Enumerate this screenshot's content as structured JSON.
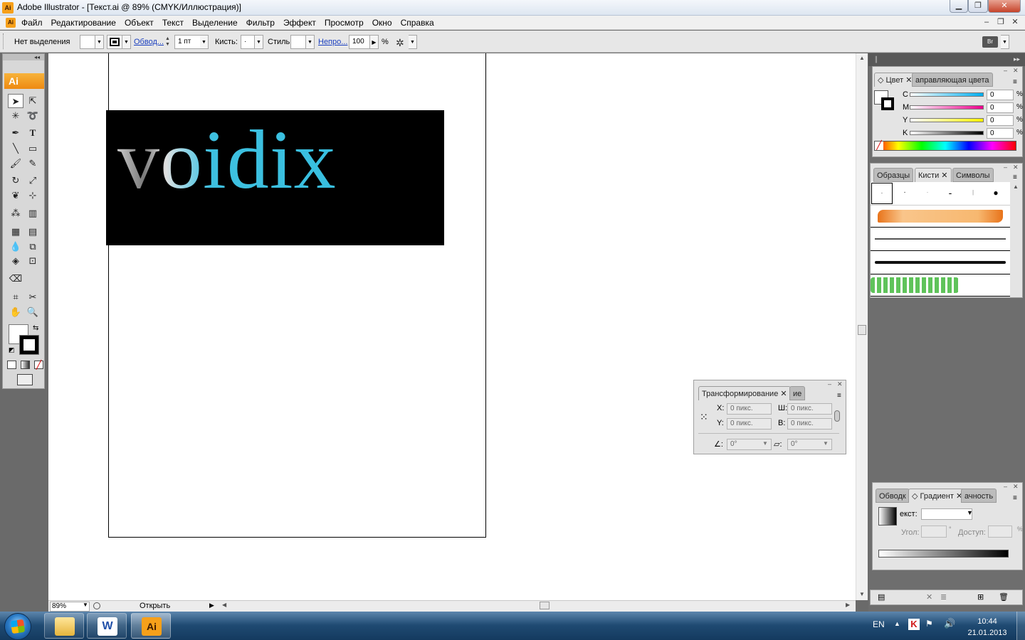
{
  "window": {
    "title": "Adobe Illustrator - [Текст.ai @ 89% (CMYK/Иллюстрация)]",
    "app_icon": "Ai"
  },
  "menu": [
    "Файл",
    "Редактирование",
    "Объект",
    "Текст",
    "Выделение",
    "Фильтр",
    "Эффект",
    "Просмотр",
    "Окно",
    "Справка"
  ],
  "control": {
    "selection_status": "Нет выделения",
    "stroke_link": "Обвод...",
    "stroke_weight": "1 пт",
    "brush_label": "Кисть:",
    "brush_value": "·",
    "style_label": "Стиль:",
    "opacity_link": "Непро...",
    "opacity_value": "100",
    "percent": "%"
  },
  "tools": {
    "logo": "Ai"
  },
  "artwork": {
    "logo_text": "voidix"
  },
  "status": {
    "zoom": "89%",
    "status_text": "Открыть"
  },
  "color_panel": {
    "tab_color": "Цвет",
    "tab_guide": "аправляющая цвета",
    "channels": [
      {
        "label": "C",
        "value": "0",
        "pct": "%"
      },
      {
        "label": "M",
        "value": "0",
        "pct": "%"
      },
      {
        "label": "Y",
        "value": "0",
        "pct": "%"
      },
      {
        "label": "K",
        "value": "0",
        "pct": "%"
      }
    ]
  },
  "brushes_panel": {
    "tab_swatches": "Образцы",
    "tab_brushes": "Кисти",
    "tab_symbols": "Символы"
  },
  "transform_panel": {
    "tab_transform": "Трансформирование",
    "tab_other": "ие",
    "x_label": "X:",
    "y_label": "Y:",
    "w_label": "Ш:",
    "h_label": "В:",
    "x_value": "0 пикс.",
    "y_value": "0 пикс.",
    "w_value": "0 пикс.",
    "h_value": "0 пикс.",
    "angle_value": "0°",
    "shear_value": "0°"
  },
  "gradient_panel": {
    "tab_stroke": "Обводк",
    "tab_gradient": "Градиент",
    "tab_transparency": "ачность",
    "type_label": "екст:",
    "angle_label": "Угол:",
    "location_label": "Доступ:",
    "degree": "°"
  },
  "taskbar": {
    "language": "EN",
    "time": "10:44",
    "date": "21.01.2013"
  }
}
